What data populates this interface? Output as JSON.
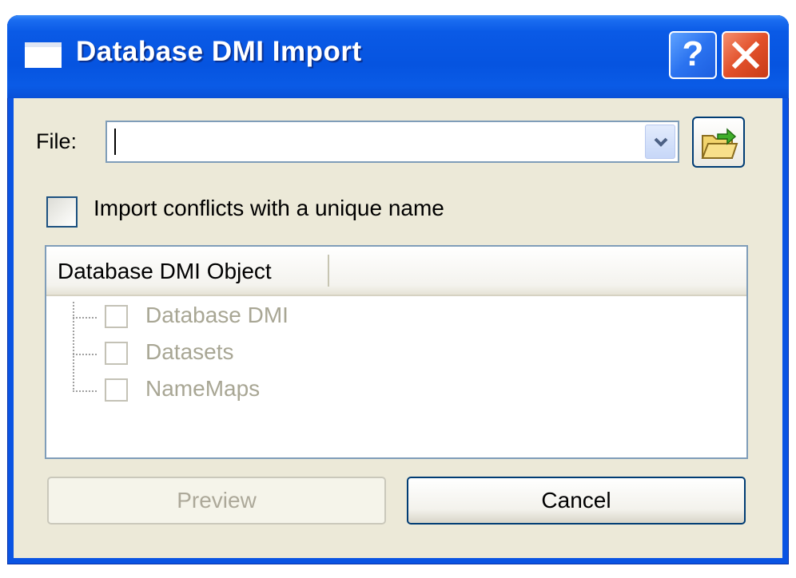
{
  "window": {
    "title": "Database DMI Import",
    "help_glyph": "?",
    "close_icon": "close-x-icon"
  },
  "file": {
    "label": "File:",
    "value": "",
    "dropdown_icon": "chevron-down-icon",
    "browse_icon": "open-folder-icon"
  },
  "options": {
    "unique_name_label": "Import conflicts with a unique name",
    "unique_name_checked": false
  },
  "tree": {
    "column_header": "Database DMI Object",
    "items": [
      {
        "label": "Database DMI",
        "checked": false
      },
      {
        "label": "Datasets",
        "checked": false
      },
      {
        "label": "NameMaps",
        "checked": false
      }
    ]
  },
  "buttons": {
    "preview_label": "Preview",
    "cancel_label": "Cancel"
  },
  "colors": {
    "titlebar": "#0a54e3",
    "client_bg": "#ece9d8",
    "close_red": "#e2502a",
    "disabled_text": "#aca899"
  }
}
